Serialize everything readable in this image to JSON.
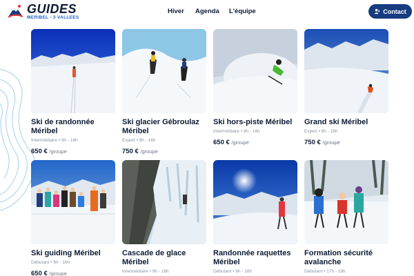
{
  "brand": {
    "name": "GUIDES",
    "tagline": "MERIBEL - 3 VALLEES"
  },
  "nav": {
    "items": [
      "Hiver",
      "Agenda",
      "L'équipe"
    ]
  },
  "contact": {
    "label": "Contact"
  },
  "price_separator": "/",
  "cards": [
    {
      "title": "Ski de randonnée Méribel",
      "meta": "Intermédiaire • 9h - 16h",
      "price": "650 €",
      "unit": "groupe"
    },
    {
      "title": "Ski glacier Gébroulaz Méribel",
      "meta": "Expert • 9h - 16h",
      "price": "750 €",
      "unit": "groupe"
    },
    {
      "title": "Ski hors-piste Méribel",
      "meta": "Intermédiaire • 9h - 16h",
      "price": "650 €",
      "unit": "groupe"
    },
    {
      "title": "Grand ski Méribel",
      "meta": "Expert • 9h - 16h",
      "price": "750 €",
      "unit": "groupe"
    },
    {
      "title": "Ski guiding Méribel",
      "meta": "Débutant • 9h - 16h",
      "price": "650 €",
      "unit": "groupe"
    },
    {
      "title": "Cascade de glace Méribel",
      "meta": "Intermédiaire • 9h - 16h",
      "price": "",
      "unit": ""
    },
    {
      "title": "Randonnée raquettes Méribel",
      "meta": "Débutant • 9h - 16h",
      "price": "",
      "unit": ""
    },
    {
      "title": "Formation sécurité avalanche",
      "meta": "Débutant • 17h - 19h",
      "price": "",
      "unit": ""
    }
  ],
  "colors": {
    "brand_navy": "#163b80",
    "text_dark": "#0c1a33",
    "text_muted": "#8a93a3",
    "accent_blue": "#1f5fbf"
  },
  "icons": {
    "contact": "user-plus-icon",
    "logo": "mountain-logo-icon"
  }
}
